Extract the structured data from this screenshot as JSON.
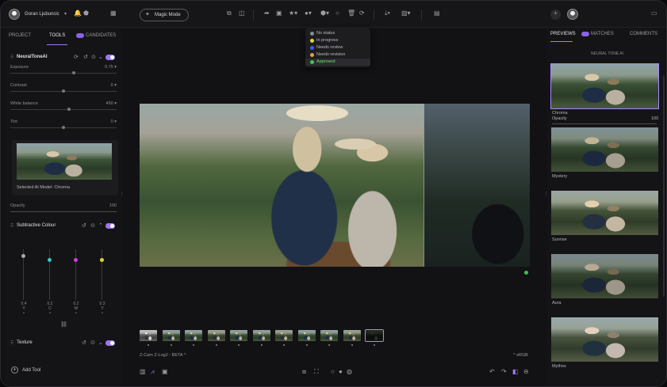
{
  "header": {
    "user_name": "Goran Ljubuncic",
    "magic_button": "Magic Mode"
  },
  "left_panel": {
    "tabs": [
      "PROJECT",
      "TOOLS",
      "CANDIDATES"
    ],
    "active_tab": "TOOLS",
    "candidates_count": "",
    "neural_tone": {
      "title": "NeuralToneAI",
      "sliders": [
        {
          "label": "Exposure",
          "value": "0.75 ▾",
          "position": 0.6
        },
        {
          "label": "Contrast",
          "value": "0 ▾",
          "position": 0.5
        },
        {
          "label": "White balance",
          "value": "450 ▾",
          "position": 0.55
        },
        {
          "label": "Tint",
          "value": "0 ▾",
          "position": 0.5
        }
      ],
      "preview_caption": "Selected AI Model: Chroma",
      "opacity_label": "Opacity",
      "opacity_value": "100"
    },
    "subtractive": {
      "title": "Subtractive Colour",
      "channels": [
        {
          "value": "0.4",
          "name": "Y",
          "color": "#a9a9b0",
          "level": 0.9
        },
        {
          "value": "0.2",
          "name": "C",
          "color": "#35c7c7",
          "level": 0.82
        },
        {
          "value": "0.2",
          "name": "M",
          "color": "#d13fd6",
          "level": 0.82
        },
        {
          "value": "0.3",
          "name": "Y",
          "color": "#d9d631",
          "level": 0.82
        }
      ]
    },
    "texture_title": "Texture",
    "add_tool": "Add Tool"
  },
  "status_dropdown": {
    "items": [
      {
        "label": "No status",
        "color": "#8a8a92"
      },
      {
        "label": "In progress",
        "color": "#e3d83a"
      },
      {
        "label": "Needs review",
        "color": "#3a5ee8"
      },
      {
        "label": "Needs revision",
        "color": "#e7a42a"
      },
      {
        "label": "Approved",
        "color": "#42c455"
      }
    ],
    "highlighted": 4
  },
  "center": {
    "camera_label": "Z-Cam Z-Log2 - BETA ^",
    "color_space": "^ sRGB",
    "status_dot_color": "#3fbf4a"
  },
  "right_panel": {
    "tabs": [
      "PREVIEWS",
      "MATCHES",
      "COMMENTS"
    ],
    "active_tab": "PREVIEWS",
    "matches_count": "",
    "section_title": "NEURAL TONE AI",
    "previews": [
      {
        "label": "Chroma",
        "selected": true
      },
      {
        "label": "Mystery",
        "selected": false
      },
      {
        "label": "Sunrise",
        "selected": false
      },
      {
        "label": "Aura",
        "selected": false
      },
      {
        "label": "Mythos",
        "selected": false
      }
    ],
    "opacity_label": "Opacity",
    "opacity_value": "100"
  }
}
